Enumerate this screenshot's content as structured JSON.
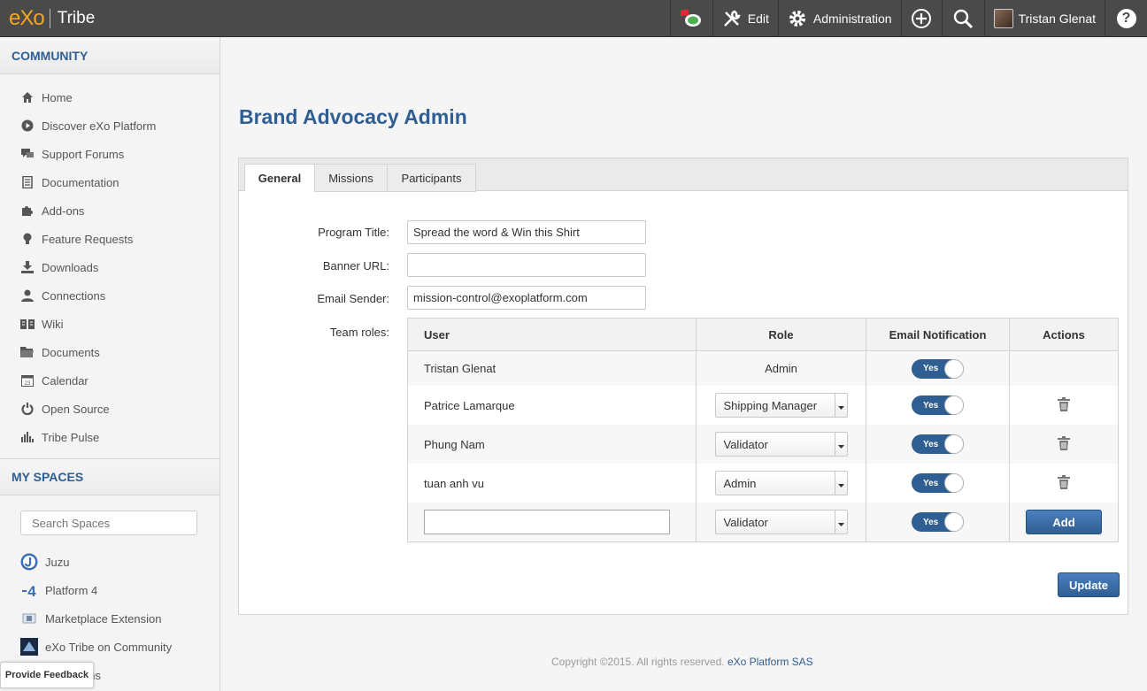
{
  "topbar": {
    "logo": "eXo",
    "product": "Tribe",
    "edit_label": "Edit",
    "admin_label": "Administration",
    "user_name": "Tristan Glenat",
    "help_glyph": "?"
  },
  "sidebar": {
    "community_title": "COMMUNITY",
    "items": [
      {
        "label": "Home",
        "icon": "home-icon"
      },
      {
        "label": "Discover eXo Platform",
        "icon": "play-icon"
      },
      {
        "label": "Support Forums",
        "icon": "chat-icon"
      },
      {
        "label": "Documentation",
        "icon": "document-icon"
      },
      {
        "label": "Add-ons",
        "icon": "puzzle-icon"
      },
      {
        "label": "Feature Requests",
        "icon": "lightbulb-icon"
      },
      {
        "label": "Downloads",
        "icon": "download-icon"
      },
      {
        "label": "Connections",
        "icon": "user-icon"
      },
      {
        "label": "Wiki",
        "icon": "book-icon"
      },
      {
        "label": "Documents",
        "icon": "folder-icon"
      },
      {
        "label": "Calendar",
        "icon": "calendar-icon"
      },
      {
        "label": "Open Source",
        "icon": "power-icon"
      },
      {
        "label": "Tribe Pulse",
        "icon": "bar-chart-icon"
      }
    ],
    "spaces_title": "MY SPACES",
    "search_placeholder": "Search Spaces",
    "spaces": [
      {
        "label": "Juzu"
      },
      {
        "label": "Platform 4"
      },
      {
        "label": "Marketplace Extension"
      },
      {
        "label": "eXo Tribe on Community"
      },
      {
        "label": "ons"
      }
    ],
    "feedback_label": "Provide Feedback"
  },
  "main": {
    "title": "Brand Advocacy Admin",
    "tabs": [
      {
        "label": "General"
      },
      {
        "label": "Missions"
      },
      {
        "label": "Participants"
      }
    ],
    "form": {
      "program_title_label": "Program Title:",
      "program_title_value": "Spread the word & Win this Shirt",
      "banner_url_label": "Banner URL:",
      "banner_url_value": "",
      "email_sender_label": "Email Sender:",
      "email_sender_value": "mission-control@exoplatform.com",
      "team_roles_label": "Team roles:"
    },
    "roles_table": {
      "headers": {
        "user": "User",
        "role": "Role",
        "email": "Email Notification",
        "actions": "Actions"
      },
      "rows": [
        {
          "user": "Tristan Glenat",
          "role": "Admin",
          "notify": "Yes"
        },
        {
          "user": "Patrice Lamarque",
          "role": "Shipping Manager",
          "notify": "Yes"
        },
        {
          "user": "Phung Nam",
          "role": "Validator",
          "notify": "Yes"
        },
        {
          "user": "tuan anh vu",
          "role": "Admin",
          "notify": "Yes"
        }
      ],
      "new_row": {
        "role": "Validator",
        "notify": "Yes",
        "add_label": "Add"
      }
    },
    "update_label": "Update",
    "footer_text": "Copyright ©2015. All rights reserved.",
    "footer_link": "eXo Platform SAS"
  }
}
